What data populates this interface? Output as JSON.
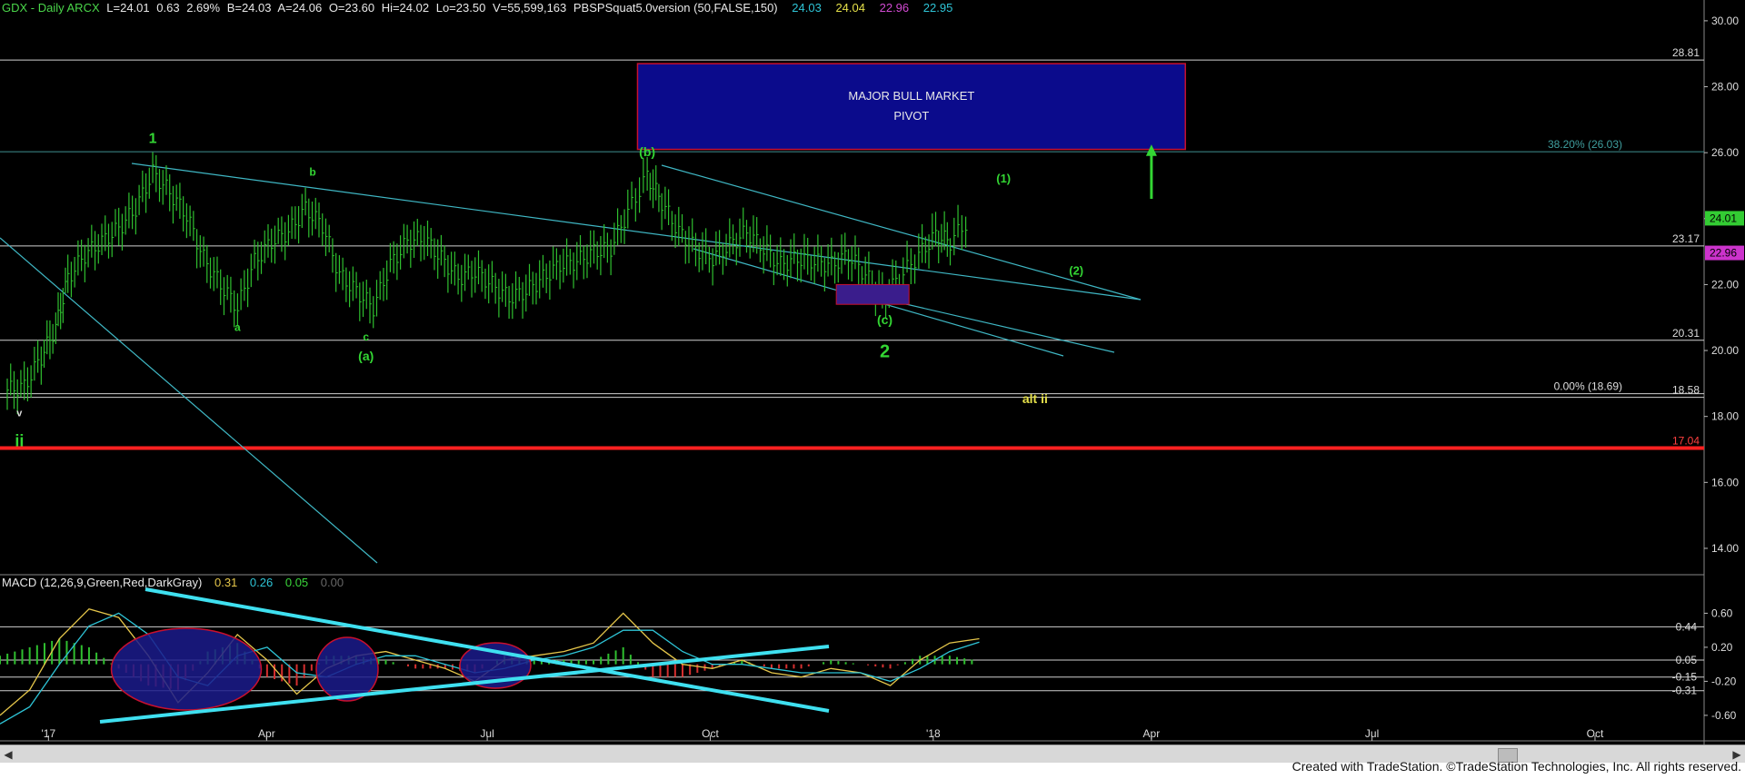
{
  "header": {
    "symbol": "GDX - Daily  ARCX",
    "last": "L=24.01",
    "change": "0.63",
    "pct": "2.69%",
    "bid": "B=24.03",
    "ask": "A=24.06",
    "open": "O=23.60",
    "high": "Hi=24.02",
    "low": "Lo=23.50",
    "volume": "V=55,599,163",
    "study": "PBSPSquat5.0version (50,FALSE,150)",
    "v1": "24.03",
    "v2": "24.04",
    "v3": "22.96",
    "v4": "22.95",
    "colors": {
      "v1": "#2ec4d6",
      "v2": "#e5e04a",
      "v3": "#d24ad2",
      "v4": "#2ec4d6"
    }
  },
  "macd_header": {
    "label": "MACD (12,26,9,Green,Red,DarkGray)",
    "v1": "0.31",
    "v2": "0.26",
    "v3": "0.05",
    "v4": "0.00"
  },
  "footer": {
    "credit": "Created with TradeStation. ©TradeStation Technologies, Inc. All rights reserved."
  },
  "chart_data": [
    {
      "type": "bar",
      "title": "GDX - Daily",
      "price_axis_ticks": [
        "30.00",
        "28.00",
        "26.00",
        "24.00",
        "22.00",
        "20.00",
        "18.00",
        "16.00",
        "14.00"
      ],
      "ylim": [
        13.2,
        30.3
      ],
      "x_ticks": [
        "'17",
        "Apr",
        "Jul",
        "Oct",
        "'18",
        "Apr",
        "Jul",
        "Oct"
      ],
      "levels": [
        {
          "label": "28.81",
          "value": 28.81,
          "color": "#cfcfcf"
        },
        {
          "label": "38.20% (26.03)",
          "value": 26.03,
          "color": "#3f8f8f"
        },
        {
          "label": "23.17",
          "value": 23.17,
          "color": "#cfcfcf"
        },
        {
          "label": "20.31",
          "value": 20.31,
          "color": "#cfcfcf"
        },
        {
          "label": "0.00% (18.69)",
          "value": 18.69,
          "color": "#cfcfcf"
        },
        {
          "label": "18.58",
          "value": 18.58,
          "color": "#cfcfcf"
        },
        {
          "label": "17.04",
          "value": 17.04,
          "color": "#ff2020"
        }
      ],
      "price_tags": [
        {
          "label": "24.01",
          "value": 24.01,
          "bg": "#33cc33"
        },
        {
          "label": "22.96",
          "value": 22.96,
          "bg": "#cc33cc"
        }
      ],
      "box": {
        "lines": [
          "MAJOR BULL MARKET",
          "PIVOT"
        ],
        "y_top": 28.7,
        "y_bottom": 26.1
      },
      "wave_labels": [
        "1",
        "a",
        "b",
        "c",
        "(a)",
        "(b)",
        "(c)",
        "2",
        "(1)",
        "(2)",
        "v",
        "ii",
        "alt ii"
      ],
      "path": [
        {
          "d": "2016-12-15",
          "c": 18.8
        },
        {
          "d": "2016-12-22",
          "c": 18.9
        },
        {
          "d": "2016-12-29",
          "c": 19.8
        },
        {
          "d": "2017-01-04",
          "c": 20.7
        },
        {
          "d": "2017-01-09",
          "c": 22.2
        },
        {
          "d": "2017-01-16",
          "c": 22.9
        },
        {
          "d": "2017-01-23",
          "c": 23.3
        },
        {
          "d": "2017-01-30",
          "c": 23.7
        },
        {
          "d": "2017-02-06",
          "c": 24.3
        },
        {
          "d": "2017-02-13",
          "c": 25.4
        },
        {
          "d": "2017-02-20",
          "c": 24.8
        },
        {
          "d": "2017-02-27",
          "c": 24.1
        },
        {
          "d": "2017-03-06",
          "c": 22.8
        },
        {
          "d": "2017-03-13",
          "c": 22.0
        },
        {
          "d": "2017-03-20",
          "c": 21.3
        },
        {
          "d": "2017-03-27",
          "c": 22.7
        },
        {
          "d": "2017-04-03",
          "c": 23.3
        },
        {
          "d": "2017-04-10",
          "c": 23.6
        },
        {
          "d": "2017-04-17",
          "c": 24.3
        },
        {
          "d": "2017-04-24",
          "c": 23.8
        },
        {
          "d": "2017-05-01",
          "c": 22.3
        },
        {
          "d": "2017-05-08",
          "c": 21.8
        },
        {
          "d": "2017-05-15",
          "c": 21.3
        },
        {
          "d": "2017-05-22",
          "c": 22.6
        },
        {
          "d": "2017-05-29",
          "c": 23.3
        },
        {
          "d": "2017-06-05",
          "c": 23.4
        },
        {
          "d": "2017-06-12",
          "c": 22.8
        },
        {
          "d": "2017-06-19",
          "c": 22.2
        },
        {
          "d": "2017-06-26",
          "c": 22.4
        },
        {
          "d": "2017-07-03",
          "c": 22.0
        },
        {
          "d": "2017-07-10",
          "c": 21.6
        },
        {
          "d": "2017-07-17",
          "c": 21.8
        },
        {
          "d": "2017-07-24",
          "c": 22.2
        },
        {
          "d": "2017-07-31",
          "c": 22.6
        },
        {
          "d": "2017-08-07",
          "c": 22.7
        },
        {
          "d": "2017-08-14",
          "c": 23.0
        },
        {
          "d": "2017-08-21",
          "c": 23.1
        },
        {
          "d": "2017-08-28",
          "c": 24.2
        },
        {
          "d": "2017-09-05",
          "c": 25.3
        },
        {
          "d": "2017-09-11",
          "c": 24.5
        },
        {
          "d": "2017-09-18",
          "c": 23.6
        },
        {
          "d": "2017-09-25",
          "c": 23.1
        },
        {
          "d": "2017-10-02",
          "c": 22.8
        },
        {
          "d": "2017-10-09",
          "c": 23.2
        },
        {
          "d": "2017-10-16",
          "c": 23.6
        },
        {
          "d": "2017-10-23",
          "c": 23.1
        },
        {
          "d": "2017-10-30",
          "c": 22.6
        },
        {
          "d": "2017-11-06",
          "c": 22.8
        },
        {
          "d": "2017-11-13",
          "c": 22.7
        },
        {
          "d": "2017-11-20",
          "c": 22.6
        },
        {
          "d": "2017-11-27",
          "c": 22.9
        },
        {
          "d": "2017-12-04",
          "c": 22.3
        },
        {
          "d": "2017-12-11",
          "c": 21.6
        },
        {
          "d": "2017-12-18",
          "c": 22.2
        },
        {
          "d": "2017-12-26",
          "c": 22.9
        },
        {
          "d": "2018-01-02",
          "c": 23.5
        },
        {
          "d": "2018-01-08",
          "c": 23.3
        },
        {
          "d": "2018-01-16",
          "c": 24.0
        }
      ]
    },
    {
      "type": "line",
      "title": "MACD (12,26,9,Green,Red,DarkGray)",
      "axis_ticks": [
        "0.60",
        "0.20",
        "-0.20",
        "-0.60"
      ],
      "ylim": [
        -0.9,
        0.85
      ],
      "levels": [
        {
          "label": "0.44",
          "value": 0.44
        },
        {
          "label": "0.05",
          "value": 0.05
        },
        {
          "label": "-0.15",
          "value": -0.15
        },
        {
          "label": "-0.31",
          "value": -0.31
        }
      ],
      "series": [
        {
          "name": "MACD",
          "values": [
            -0.6,
            -0.3,
            0.3,
            0.65,
            0.55,
            0.1,
            -0.45,
            -0.1,
            0.35,
            0.05,
            -0.35,
            -0.05,
            0.1,
            0.15,
            0.05,
            -0.05,
            -0.2,
            0.05,
            0.1,
            0.15,
            0.25,
            0.6,
            0.25,
            0.0,
            -0.05,
            0.05,
            -0.1,
            -0.15,
            -0.05,
            -0.1,
            -0.25,
            0.05,
            0.25,
            0.3
          ]
        },
        {
          "name": "Avg",
          "values": [
            -0.7,
            -0.5,
            0.0,
            0.45,
            0.6,
            0.35,
            -0.15,
            -0.25,
            0.1,
            0.2,
            -0.1,
            -0.15,
            0.0,
            0.1,
            0.1,
            0.0,
            -0.1,
            -0.05,
            0.05,
            0.1,
            0.2,
            0.4,
            0.4,
            0.15,
            0.0,
            0.0,
            -0.05,
            -0.1,
            -0.1,
            -0.1,
            -0.2,
            -0.05,
            0.15,
            0.26
          ]
        }
      ]
    }
  ]
}
